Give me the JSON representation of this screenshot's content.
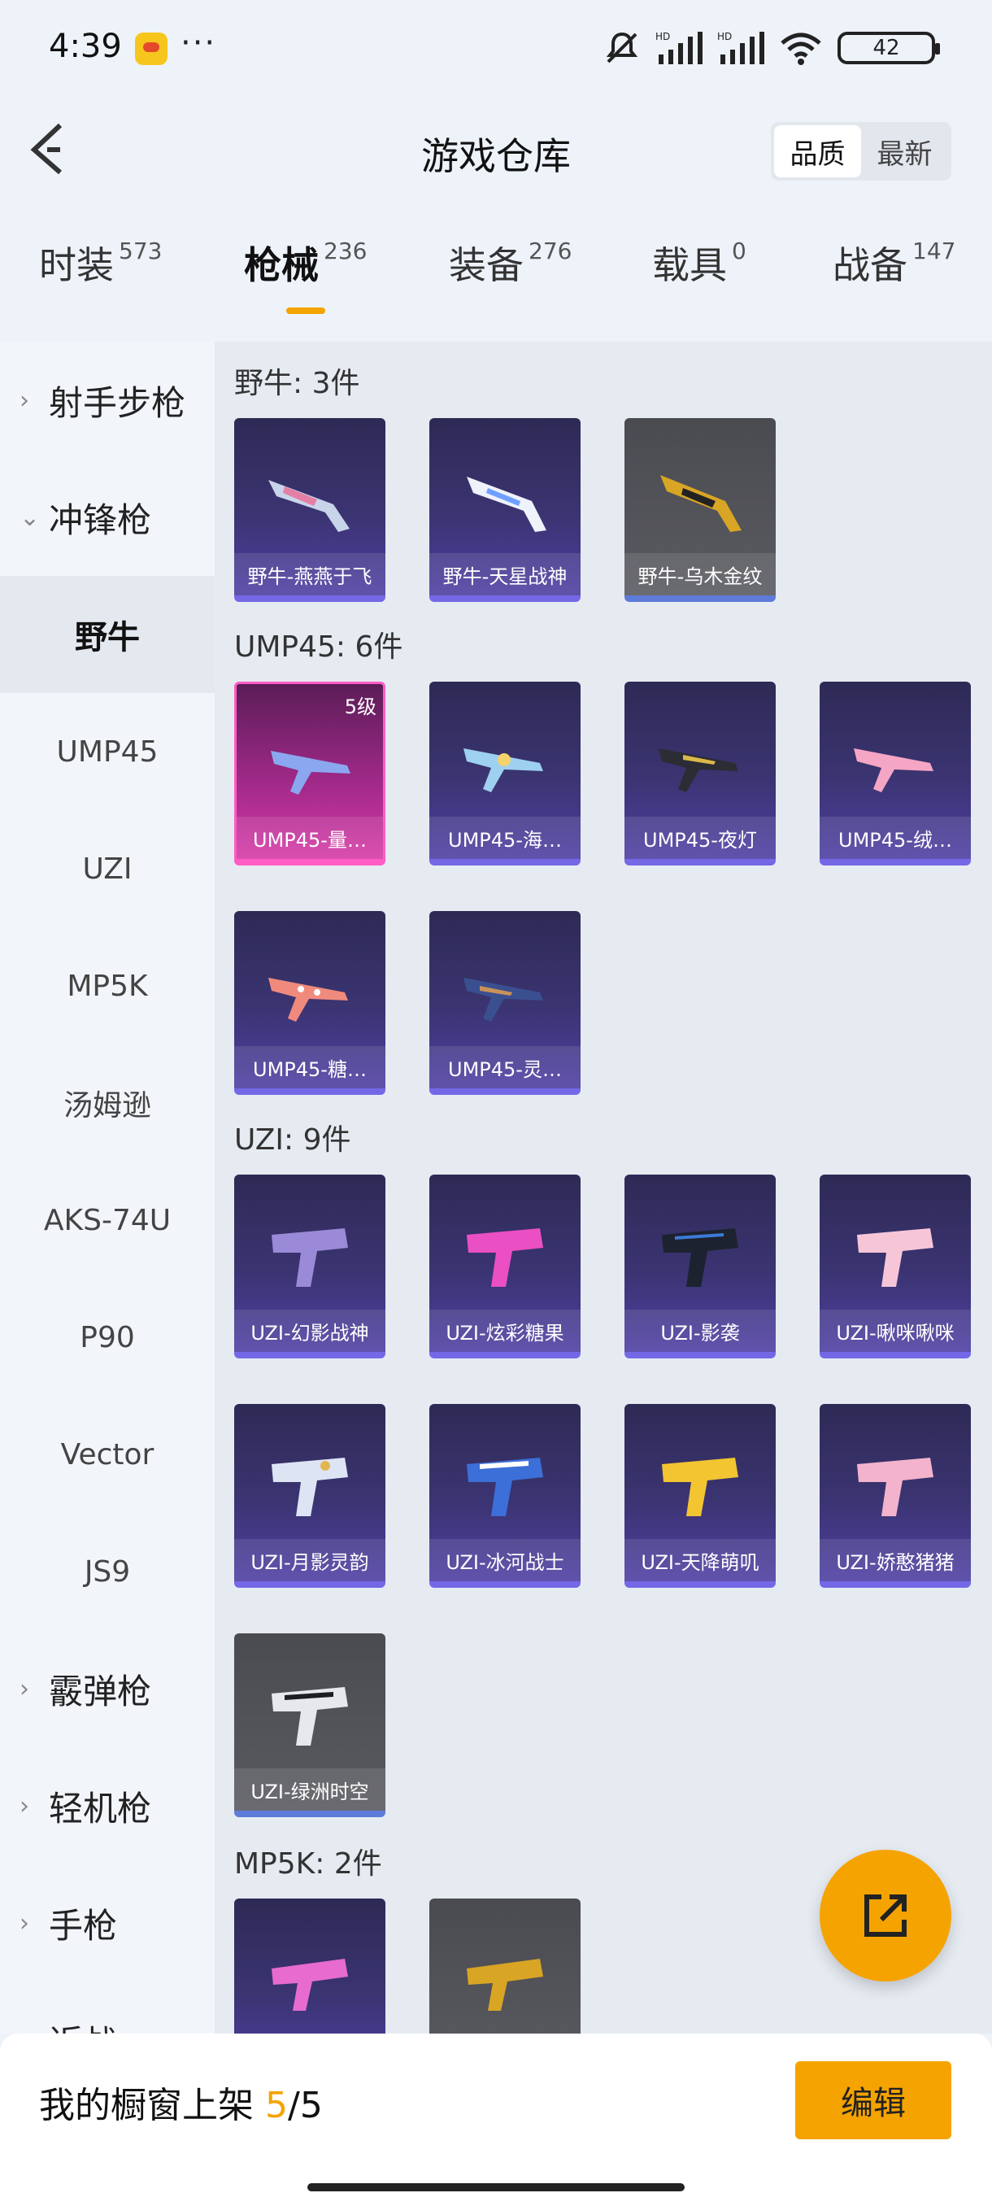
{
  "status": {
    "time": "4:39",
    "more": "···",
    "battery": "42"
  },
  "header": {
    "title": "游戏仓库",
    "sort": [
      "品质",
      "最新"
    ]
  },
  "categories": [
    {
      "name": "时装",
      "count": "573"
    },
    {
      "name": "枪械",
      "count": "236"
    },
    {
      "name": "装备",
      "count": "276"
    },
    {
      "name": "载具",
      "count": "0"
    },
    {
      "name": "战备",
      "count": "147"
    }
  ],
  "sidebar": {
    "groups": [
      "射手步枪",
      "冲锋枪",
      "霰弹枪",
      "轻机枪",
      "手枪",
      "近战"
    ],
    "subitems": [
      "野牛",
      "UMP45",
      "UZI",
      "MP5K",
      "汤姆逊",
      "AKS-74U",
      "P90",
      "Vector",
      "JS9"
    ]
  },
  "sections": [
    {
      "title": "野牛: 3件",
      "items": [
        "野牛-燕燕于飞",
        "野牛-天星战神",
        "野牛-乌木金纹"
      ]
    },
    {
      "title": "UMP45: 6件",
      "items": [
        "UMP45-量…",
        "UMP45-海…",
        "UMP45-夜灯",
        "UMP45-绒…",
        "UMP45-糖…",
        "UMP45-灵…"
      ],
      "level": "5级"
    },
    {
      "title": "UZI: 9件",
      "items": [
        "UZI-幻影战神",
        "UZI-炫彩糖果",
        "UZI-影袭",
        "UZI-啾咪啾咪",
        "UZI-月影灵韵",
        "UZI-冰河战士",
        "UZI-天降萌叽",
        "UZI-娇憨猪猪",
        "UZI-绿洲时空"
      ]
    },
    {
      "title": "MP5K: 2件",
      "items": [
        "",
        ""
      ]
    }
  ],
  "bottom": {
    "label": "我的橱窗上架 ",
    "current": "5",
    "total": "/5",
    "edit": "编辑"
  },
  "colors": {
    "accent": "#f5a300",
    "card_purple": "#3b3472",
    "card_gray": "#55565b",
    "card_pink": "#d63aa6"
  }
}
